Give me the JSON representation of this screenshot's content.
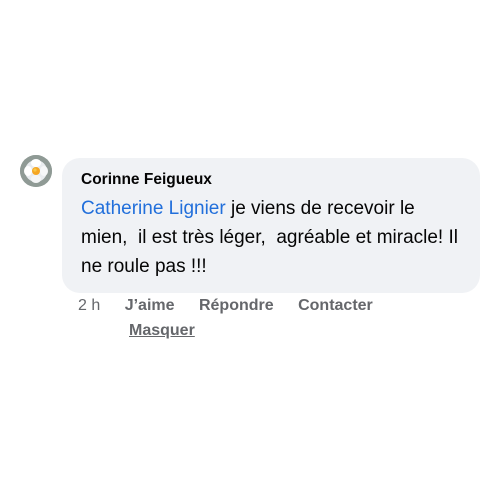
{
  "comment": {
    "author": "Corinne Feigueux",
    "mention": "Catherine Lignier",
    "text": " je viens de recevoir le mien,  il est très léger,  agréable et miracle! Il ne roule pas !!!",
    "time": "2 h",
    "actions": {
      "like": "J’aime",
      "reply": "Répondre",
      "contact": "Contacter",
      "hide": "Masquer"
    },
    "avatar_icon": "flower-avatar"
  }
}
